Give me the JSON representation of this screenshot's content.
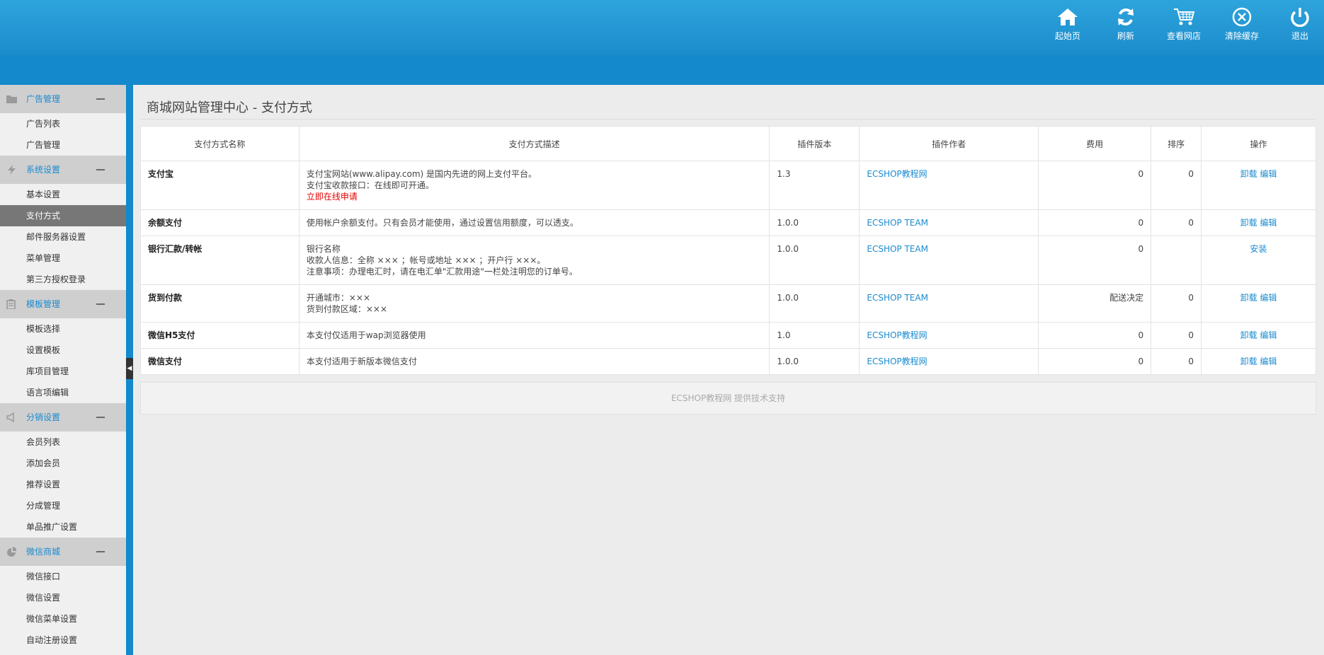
{
  "toolbar": [
    {
      "label": "起始页",
      "icon": "home-icon"
    },
    {
      "label": "刷新",
      "icon": "refresh-icon"
    },
    {
      "label": "查看网店",
      "icon": "cart-icon"
    },
    {
      "label": "清除缓存",
      "icon": "close-circle-icon"
    },
    {
      "label": "退出",
      "icon": "power-icon"
    }
  ],
  "sidebar": {
    "groups": [
      {
        "label": "广告管理",
        "icon": "folder-icon",
        "items": [
          "广告列表",
          "广告管理"
        ]
      },
      {
        "label": "系统设置",
        "icon": "lightning-icon",
        "items": [
          "基本设置",
          "支付方式",
          "邮件服务器设置",
          "菜单管理",
          "第三方授权登录"
        ]
      },
      {
        "label": "模板管理",
        "icon": "clipboard-icon",
        "items": [
          "模板选择",
          "设置模板",
          "库项目管理",
          "语言项编辑"
        ]
      },
      {
        "label": "分销设置",
        "icon": "speaker-icon",
        "items": [
          "会员列表",
          "添加会员",
          "推荐设置",
          "分成管理",
          "单品推广设置"
        ]
      },
      {
        "label": "微信商城",
        "icon": "pie-chart-icon",
        "items": [
          "微信接口",
          "微信设置",
          "微信菜单设置",
          "自动注册设置"
        ]
      }
    ],
    "active_item": "支付方式"
  },
  "page_title": "商城网站管理中心 - 支付方式",
  "table": {
    "headers": [
      "支付方式名称",
      "支付方式描述",
      "插件版本",
      "插件作者",
      "费用",
      "排序",
      "操作"
    ],
    "rows": [
      {
        "name": "支付宝",
        "desc": [
          "支付宝网站(www.alipay.com) 是国内先进的网上支付平台。",
          "支付宝收款接口：在线即可开通。"
        ],
        "desc_link": "立即在线申请",
        "version": "1.3",
        "author": "ECSHOP教程网",
        "fee": "0",
        "order": "0",
        "action1": "卸载",
        "action2": "编辑"
      },
      {
        "name": "余额支付",
        "desc": [
          "使用帐户余额支付。只有会员才能使用，通过设置信用额度，可以透支。"
        ],
        "version": "1.0.0",
        "author": "ECSHOP TEAM",
        "fee": "0",
        "order": "0",
        "action1": "卸载",
        "action2": "编辑"
      },
      {
        "name": "银行汇款/转帐",
        "desc": [
          "银行名称",
          "收款人信息：全称 ××× ；帐号或地址 ××× ；开户行 ×××。",
          "注意事项：办理电汇时，请在电汇单\"汇款用途\"一栏处注明您的订单号。"
        ],
        "version": "1.0.0",
        "author": "ECSHOP TEAM",
        "fee": "0",
        "order": "",
        "action1": "安装",
        "action2": ""
      },
      {
        "name": "货到付款",
        "desc": [
          "开通城市：×××",
          "货到付款区域：×××"
        ],
        "version": "1.0.0",
        "author": "ECSHOP TEAM",
        "fee": "配送决定",
        "order": "0",
        "action1": "卸载",
        "action2": "编辑"
      },
      {
        "name": "微信H5支付",
        "desc": [
          "本支付仅适用于wap浏览器使用"
        ],
        "version": "1.0",
        "author": "ECSHOP教程网",
        "fee": "0",
        "order": "0",
        "action1": "卸载",
        "action2": "编辑"
      },
      {
        "name": "微信支付",
        "desc": [
          "本支付适用于新版本微信支付"
        ],
        "version": "1.0.0",
        "author": "ECSHOP教程网",
        "fee": "0",
        "order": "0",
        "action1": "卸载",
        "action2": "编辑"
      }
    ]
  },
  "footer": "ECSHOP教程网 提供技术支持"
}
